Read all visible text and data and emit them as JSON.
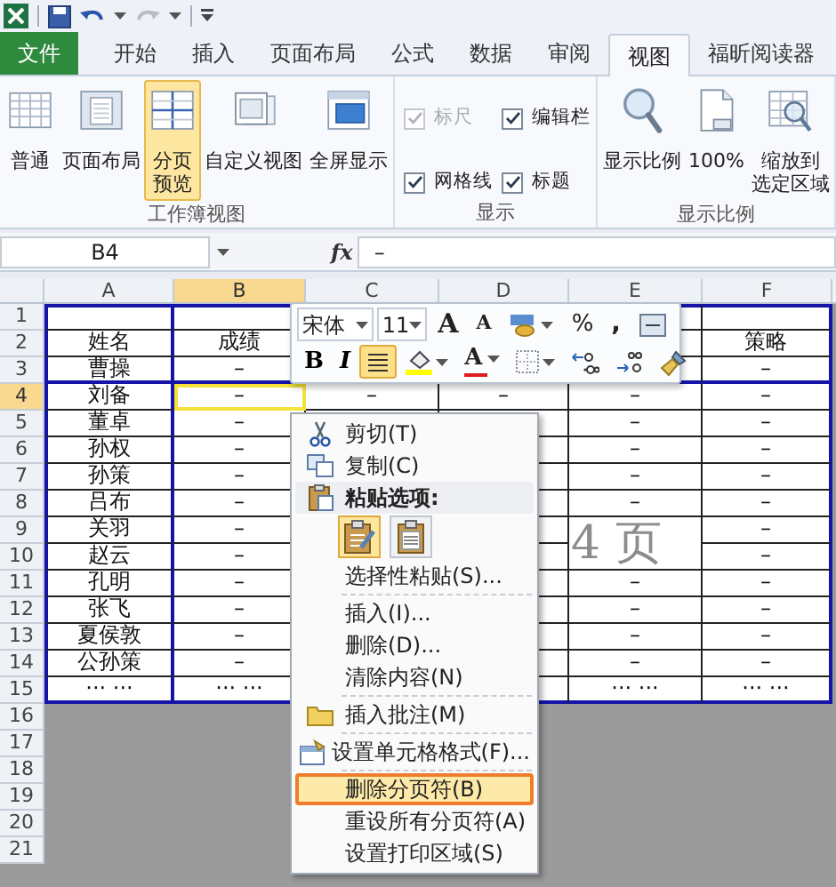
{
  "tabs": [
    {
      "label": "文件",
      "kind": "file",
      "selected": false
    },
    {
      "label": "开始",
      "kind": "tab",
      "selected": false
    },
    {
      "label": "插入",
      "kind": "tab",
      "selected": false
    },
    {
      "label": "页面布局",
      "kind": "tab",
      "selected": false
    },
    {
      "label": "公式",
      "kind": "tab",
      "selected": false
    },
    {
      "label": "数据",
      "kind": "tab",
      "selected": false
    },
    {
      "label": "审阅",
      "kind": "tab",
      "selected": false
    },
    {
      "label": "视图",
      "kind": "tab",
      "selected": true
    },
    {
      "label": "福昕阅读器",
      "kind": "tab",
      "selected": false
    }
  ],
  "ribbon": {
    "groups": [
      {
        "title": "工作簿视图",
        "kind": "buttons",
        "buttons": [
          {
            "kind": "normal",
            "lines": [
              "普通"
            ],
            "selected": false
          },
          {
            "kind": "page-layout",
            "lines": [
              "页面布局"
            ],
            "selected": false
          },
          {
            "kind": "page-break",
            "lines": [
              "分页",
              "预览"
            ],
            "selected": true
          },
          {
            "kind": "custom-view",
            "lines": [
              "自定义视图"
            ],
            "selected": false
          },
          {
            "kind": "full-screen",
            "lines": [
              "全屏显示"
            ],
            "selected": false
          }
        ]
      },
      {
        "title": "显示",
        "kind": "checkboxes",
        "checkboxes": [
          {
            "label": "标尺",
            "checked": true,
            "disabled": true
          },
          {
            "label": "编辑栏",
            "checked": true,
            "disabled": false
          },
          {
            "label": "网格线",
            "checked": true,
            "disabled": false
          },
          {
            "label": "标题",
            "checked": true,
            "disabled": false
          }
        ]
      },
      {
        "title": "显示比例",
        "kind": "buttons",
        "buttons": [
          {
            "kind": "zoom",
            "lines": [
              "显示比例"
            ],
            "selected": false
          },
          {
            "kind": "zoom-100",
            "lines": [
              "100%"
            ],
            "selected": false
          },
          {
            "kind": "zoom-selection",
            "lines": [
              "缩放到",
              "选定区域"
            ],
            "selected": false
          }
        ]
      }
    ]
  },
  "formula_bar": {
    "name_box": "B4",
    "function_label": "fx",
    "value": "–"
  },
  "sheet": {
    "columns": [
      {
        "label": "A",
        "selected": false
      },
      {
        "label": "B",
        "selected": true
      },
      {
        "label": "C",
        "selected": false
      },
      {
        "label": "D",
        "selected": false
      },
      {
        "label": "E",
        "selected": false
      },
      {
        "label": "F",
        "selected": false
      }
    ],
    "rows": [
      {
        "label": "1",
        "selected": false,
        "cells": [
          null,
          null,
          null,
          null,
          null,
          null
        ]
      },
      {
        "label": "2",
        "selected": false,
        "cells": [
          "姓名",
          "成绩",
          null,
          null,
          null,
          "策略"
        ]
      },
      {
        "label": "3",
        "selected": false,
        "cells": [
          "曹操",
          "–",
          null,
          null,
          null,
          "–"
        ]
      },
      {
        "label": "4",
        "selected": true,
        "cells": [
          "刘备",
          "–",
          "–",
          "–",
          "–",
          "–"
        ]
      },
      {
        "label": "5",
        "selected": false,
        "cells": [
          "董卓",
          "–",
          null,
          null,
          "–",
          "–"
        ]
      },
      {
        "label": "6",
        "selected": false,
        "cells": [
          "孙权",
          "–",
          null,
          null,
          "–",
          "–"
        ]
      },
      {
        "label": "7",
        "selected": false,
        "cells": [
          "孙策",
          "–",
          null,
          null,
          "–",
          "–"
        ]
      },
      {
        "label": "8",
        "selected": false,
        "cells": [
          "吕布",
          "–",
          null,
          null,
          "–",
          "–"
        ]
      },
      {
        "label": "9",
        "selected": false,
        "cells": [
          "关羽",
          "–",
          null,
          null,
          null,
          "–"
        ]
      },
      {
        "label": "10",
        "selected": false,
        "cells": [
          "赵云",
          "–",
          null,
          null,
          null,
          "–"
        ]
      },
      {
        "label": "11",
        "selected": false,
        "cells": [
          "孔明",
          "–",
          null,
          null,
          "–",
          "–"
        ]
      },
      {
        "label": "12",
        "selected": false,
        "cells": [
          "张飞",
          "–",
          null,
          null,
          "–",
          "–"
        ]
      },
      {
        "label": "13",
        "selected": false,
        "cells": [
          "夏侯敦",
          "–",
          null,
          null,
          "–",
          "–"
        ]
      },
      {
        "label": "14",
        "selected": false,
        "cells": [
          "公孙策",
          "–",
          null,
          null,
          "–",
          "–"
        ]
      },
      {
        "label": "15",
        "selected": false,
        "cells": [
          "··· ···",
          "··· ···",
          null,
          null,
          "··· ···",
          "··· ···"
        ]
      }
    ],
    "outside_rows": [
      "16",
      "17",
      "18",
      "19",
      "20",
      "21"
    ],
    "page_label": "4 页"
  },
  "mini_toolbar": {
    "font": "宋体",
    "size": "11",
    "row1": [
      {
        "kind": "grow",
        "label": "A"
      },
      {
        "kind": "shrink",
        "label": "A"
      },
      {
        "kind": "accounting"
      },
      {
        "kind": "percent",
        "label": "%"
      },
      {
        "kind": "comma",
        "label": ","
      },
      {
        "kind": "merge"
      }
    ],
    "row2": [
      {
        "kind": "bold",
        "label": "B",
        "on": false
      },
      {
        "kind": "italic",
        "label": "I",
        "on": false
      },
      {
        "kind": "center",
        "on": true
      },
      {
        "kind": "fill",
        "on": false
      },
      {
        "kind": "font-color",
        "label": "A",
        "on": false
      },
      {
        "kind": "borders",
        "on": false
      },
      {
        "kind": "inc-decimal",
        "on": false
      },
      {
        "kind": "dec-decimal",
        "on": false
      },
      {
        "kind": "painter",
        "on": false
      }
    ]
  },
  "context_menu": {
    "items": [
      {
        "kind": "cut",
        "label": "剪切(T)",
        "selected": false
      },
      {
        "kind": "copy",
        "label": "复制(C)",
        "selected": false
      },
      {
        "kind": "paste-header",
        "label": "粘贴选项:",
        "selected": false
      },
      {
        "kind": "paste-buttons"
      },
      {
        "kind": "item",
        "label": "选择性粘贴(S)...",
        "selected": false
      },
      {
        "kind": "separator"
      },
      {
        "kind": "item",
        "label": "插入(I)...",
        "selected": false
      },
      {
        "kind": "item",
        "label": "删除(D)...",
        "selected": false
      },
      {
        "kind": "item",
        "label": "清除内容(N)",
        "selected": false
      },
      {
        "kind": "separator"
      },
      {
        "kind": "comment",
        "label": "插入批注(M)",
        "selected": false
      },
      {
        "kind": "separator"
      },
      {
        "kind": "format-cells",
        "label": "设置单元格格式(F)...",
        "selected": false
      },
      {
        "kind": "separator"
      },
      {
        "kind": "item",
        "label": "删除分页符(B)",
        "selected": true
      },
      {
        "kind": "item",
        "label": "重设所有分页符(A)",
        "selected": false
      },
      {
        "kind": "item",
        "label": "设置打印区域(S)",
        "selected": false
      }
    ]
  }
}
